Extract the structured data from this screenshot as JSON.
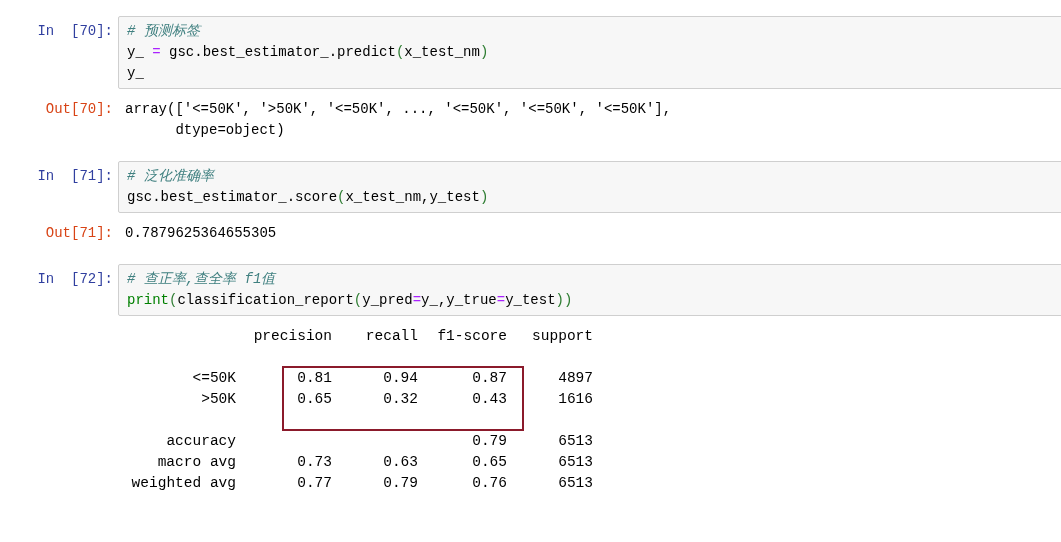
{
  "cells": [
    {
      "prompt": "In  [70]:",
      "lines": [
        [
          {
            "kind": "comment",
            "text": "# 预测标签"
          }
        ],
        [
          {
            "kind": "plain",
            "text": "y_ "
          },
          {
            "kind": "operator",
            "text": "="
          },
          {
            "kind": "plain",
            "text": " gsc.best_estimator_.predict"
          },
          {
            "kind": "paren",
            "text": "("
          },
          {
            "kind": "plain",
            "text": "x_test_nm"
          },
          {
            "kind": "paren",
            "text": ")"
          }
        ],
        [
          {
            "kind": "plain",
            "text": "y_"
          }
        ]
      ],
      "output": {
        "prompt": "Out[70]:",
        "kind": "text",
        "lines": [
          "array(['<=50K', '>50K', '<=50K', ..., '<=50K', '<=50K', '<=50K'],",
          "      dtype=object)"
        ]
      }
    },
    {
      "prompt": "In  [71]:",
      "lines": [
        [
          {
            "kind": "comment",
            "text": "# 泛化准确率"
          }
        ],
        [
          {
            "kind": "plain",
            "text": "gsc.best_estimator_.score"
          },
          {
            "kind": "paren",
            "text": "("
          },
          {
            "kind": "plain",
            "text": "x_test_nm,y_test"
          },
          {
            "kind": "paren",
            "text": ")"
          }
        ]
      ],
      "output": {
        "prompt": "Out[71]:",
        "kind": "text",
        "lines": [
          "0.7879625364655305"
        ]
      }
    },
    {
      "prompt": "In  [72]:",
      "lines": [
        [
          {
            "kind": "comment",
            "text": "# 查正率,查全率 f1值"
          }
        ],
        [
          {
            "kind": "builtin",
            "text": "print"
          },
          {
            "kind": "paren",
            "text": "("
          },
          {
            "kind": "plain",
            "text": "classification_report"
          },
          {
            "kind": "paren",
            "text": "("
          },
          {
            "kind": "plain",
            "text": "y_pred"
          },
          {
            "kind": "operator",
            "text": "="
          },
          {
            "kind": "plain",
            "text": "y_,y_true"
          },
          {
            "kind": "operator",
            "text": "="
          },
          {
            "kind": "plain",
            "text": "y_test"
          },
          {
            "kind": "paren",
            "text": "))"
          }
        ]
      ],
      "output": {
        "kind": "report",
        "columns": [
          "precision",
          "recall",
          "f1-score",
          "support"
        ],
        "groups": [
          {
            "highlighted": true,
            "rows": [
              [
                "<=50K",
                "0.81",
                "0.94",
                "0.87",
                "4897"
              ],
              [
                ">50K",
                "0.65",
                "0.32",
                "0.43",
                "1616"
              ]
            ]
          },
          {
            "highlighted": false,
            "rows": [
              [
                "accuracy",
                "",
                "",
                "0.79",
                "6513"
              ],
              [
                "macro avg",
                "0.73",
                "0.63",
                "0.65",
                "6513"
              ],
              [
                "weighted avg",
                "0.77",
                "0.79",
                "0.76",
                "6513"
              ]
            ]
          }
        ]
      }
    }
  ]
}
